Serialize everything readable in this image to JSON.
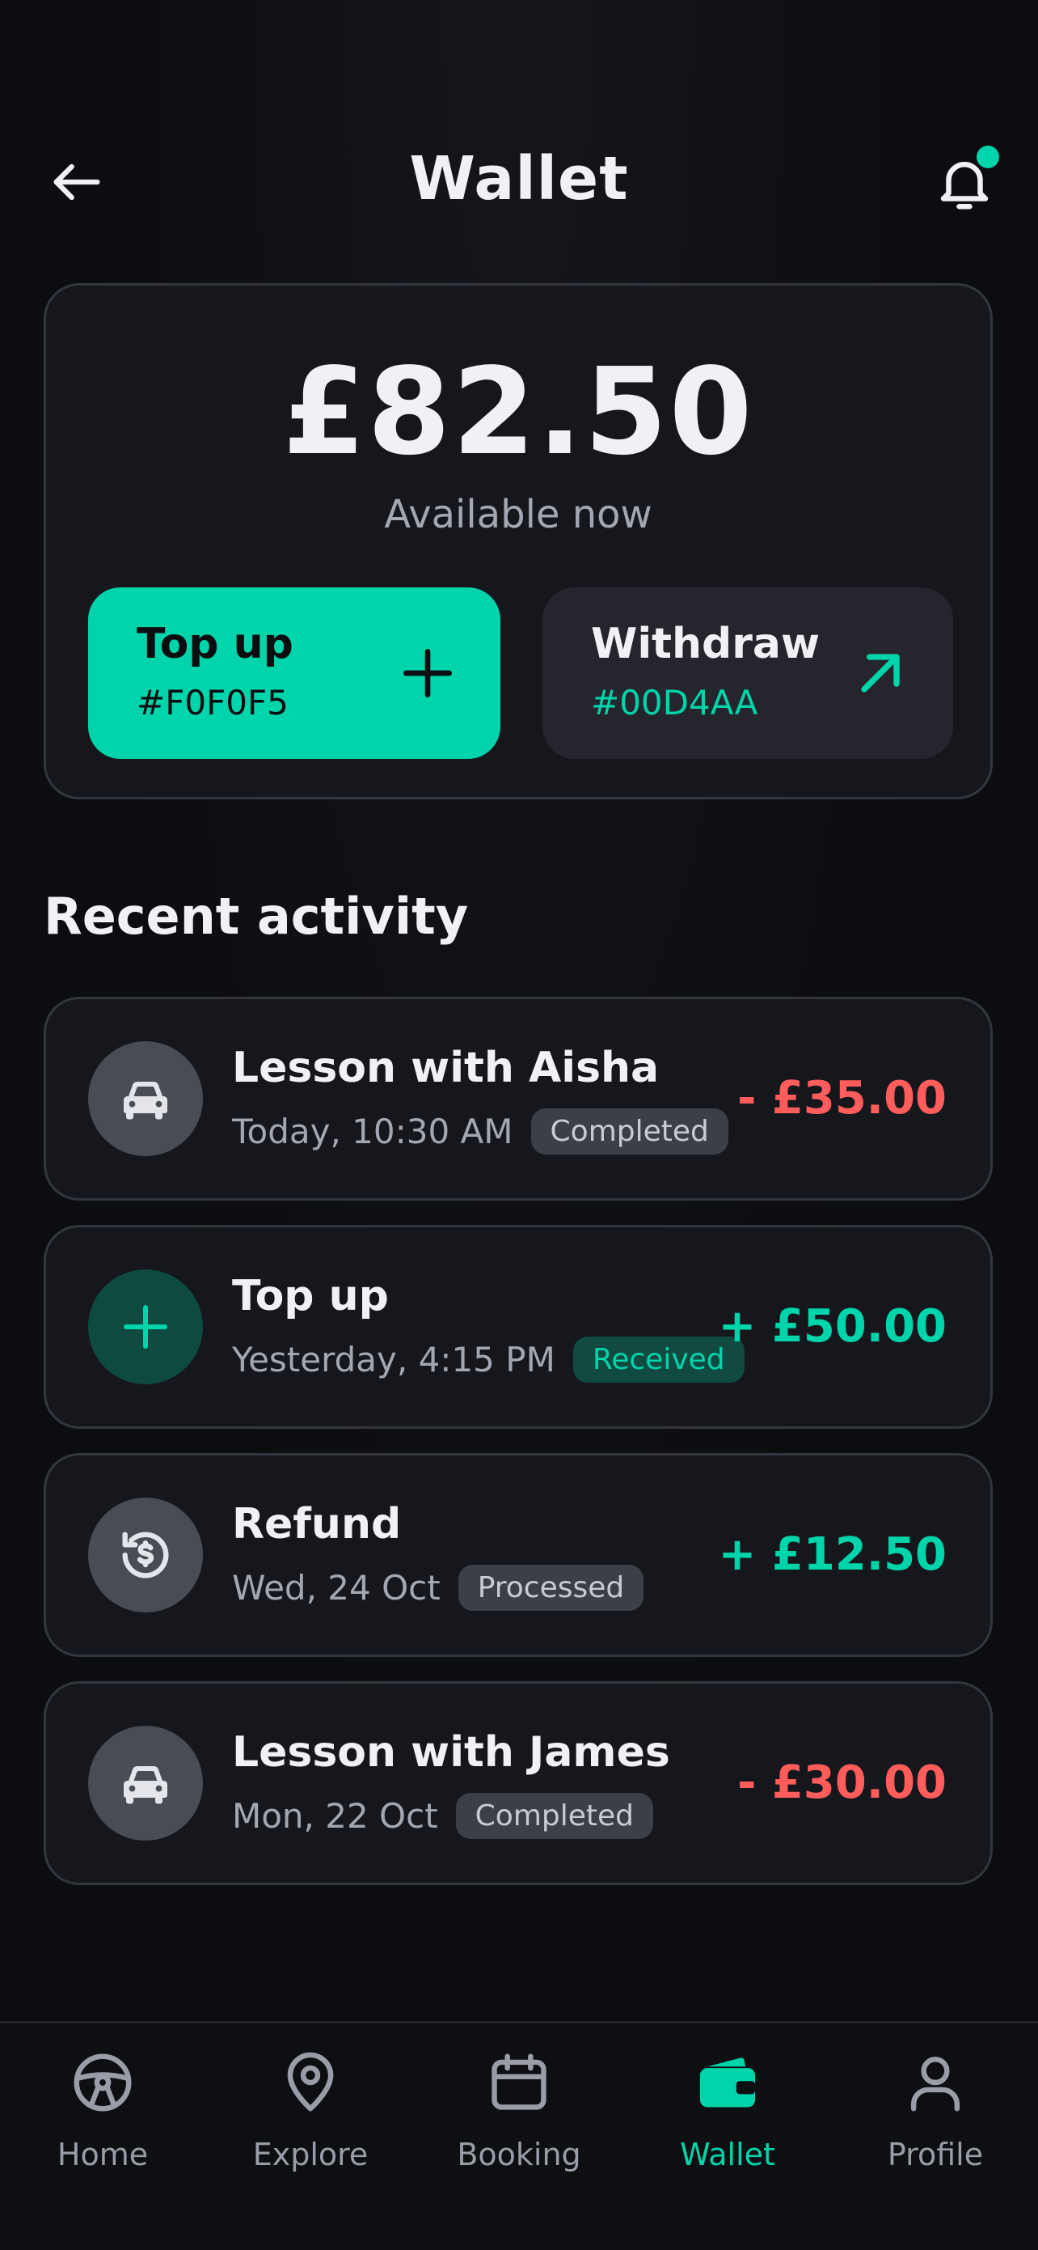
{
  "header": {
    "title": "Wallet",
    "back_icon": "arrow-left-icon",
    "notification_icon": "bell-icon",
    "notification_dot_color": "#00D4AA"
  },
  "balance": {
    "amount": "£82.50",
    "label": "Available now"
  },
  "actions": {
    "top_up": {
      "label": "Top up",
      "sub": "#F0F0F5",
      "icon": "plus-icon"
    },
    "withdraw": {
      "label": "Withdraw",
      "sub": "#00D4AA",
      "icon": "arrow-up-right-icon"
    }
  },
  "section_title": "Recent activity",
  "activity": [
    {
      "title": "Lesson with Aisha",
      "date": "Today, 10:30 AM",
      "badge": "Completed",
      "amount": "- £35.00",
      "icon": "car-icon"
    },
    {
      "title": "Top up",
      "date": "Yesterday, 4:15 PM",
      "badge": "Received",
      "amount": "+ £50.00",
      "icon": "plus-icon"
    },
    {
      "title": "Refund",
      "date": "Wed, 24 Oct",
      "badge": "Processed",
      "amount": "+ £12.50",
      "icon": "refund-icon"
    },
    {
      "title": "Lesson with James",
      "date": "Mon, 22 Oct",
      "badge": "Completed",
      "amount": "- £30.00",
      "icon": "car-icon"
    }
  ],
  "nav": {
    "items": [
      {
        "label": "Home",
        "icon": "steering-wheel-icon"
      },
      {
        "label": "Explore",
        "icon": "map-pin-icon"
      },
      {
        "label": "Booking",
        "icon": "calendar-icon"
      },
      {
        "label": "Wallet",
        "icon": "wallet-icon"
      },
      {
        "label": "Profile",
        "icon": "user-icon"
      }
    ],
    "active": "Wallet"
  },
  "colors": {
    "background": "#0C0D10",
    "card": "#16171C",
    "accent": "#00D4AA",
    "negative": "#FF5C5C",
    "text": "#F0F0F5"
  }
}
